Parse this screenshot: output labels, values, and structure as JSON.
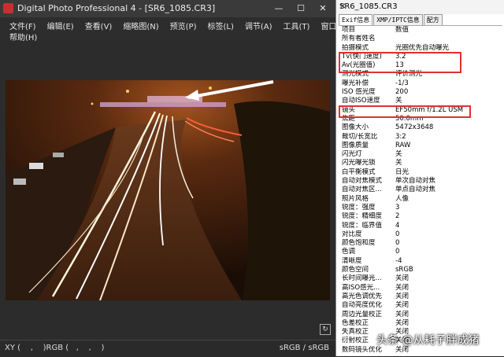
{
  "window": {
    "title": "Digital Photo Professional 4 - [SR6_1085.CR3]",
    "min_glyph": "—",
    "max_glyph": "☐",
    "close_glyph": "✕"
  },
  "menu": {
    "row1": [
      "文件(F)",
      "编辑(E)",
      "查看(V)",
      "缩略图(N)",
      "预览(P)",
      "标签(L)",
      "调节(A)",
      "工具(T)",
      "窗口(W)"
    ],
    "row2": [
      "帮助(H)"
    ]
  },
  "status": {
    "left": "XY (    ,    )RGB (   ,    ,    )",
    "right": "sRGB / sRGB"
  },
  "info_panel": {
    "title": "SR6_1085.CR3",
    "close_glyph": "✕",
    "tabs": [
      "Exif信息",
      "XMP/IPTC信息",
      "配方"
    ],
    "header": {
      "key": "项目",
      "value": "数值"
    },
    "rows": [
      {
        "k": "所有者姓名",
        "v": ""
      },
      {
        "k": "拍摄模式",
        "v": "光圈优先自动曝光"
      },
      {
        "k": "Tv(快门速度)",
        "v": "3.2"
      },
      {
        "k": "Av(光圈值)",
        "v": "13"
      },
      {
        "k": "测光模式",
        "v": "评价测光"
      },
      {
        "k": "曝光补偿",
        "v": "-1/3"
      },
      {
        "k": "ISO 感光度",
        "v": "200"
      },
      {
        "k": "自动ISO速度",
        "v": "关"
      },
      {
        "k": "镜头",
        "v": "EF50mm f/1.2L USM"
      },
      {
        "k": "焦距",
        "v": "50.0mm"
      },
      {
        "k": "图像大小",
        "v": "5472x3648"
      },
      {
        "k": "裁切/长宽比",
        "v": "3:2"
      },
      {
        "k": "图像质量",
        "v": "RAW"
      },
      {
        "k": "闪光灯",
        "v": "关"
      },
      {
        "k": "闪光曝光锁",
        "v": "关"
      },
      {
        "k": "白平衡模式",
        "v": "日光"
      },
      {
        "k": "自动对焦模式",
        "v": "单次自动对焦"
      },
      {
        "k": "自动对焦区...",
        "v": "单点自动对焦"
      },
      {
        "k": "照片风格",
        "v": "人像"
      },
      {
        "k": "锐度：强度",
        "v": "3"
      },
      {
        "k": "锐度：精细度",
        "v": "2"
      },
      {
        "k": "锐度：临界值",
        "v": "4"
      },
      {
        "k": "对比度",
        "v": "0"
      },
      {
        "k": "颜色饱和度",
        "v": "0"
      },
      {
        "k": "色调",
        "v": "0"
      },
      {
        "k": "清晰度",
        "v": "-4"
      },
      {
        "k": "颜色空间",
        "v": "sRGB"
      },
      {
        "k": "长时间曝光...",
        "v": "关闭"
      },
      {
        "k": "高ISO感光...",
        "v": "关闭"
      },
      {
        "k": "高光色调优先",
        "v": "关闭"
      },
      {
        "k": "自动亮度优化",
        "v": "关闭"
      },
      {
        "k": "周边光量校正",
        "v": "关闭"
      },
      {
        "k": "色差校正",
        "v": "关闭"
      },
      {
        "k": "失真校正",
        "v": "关闭"
      },
      {
        "k": "衍射校正",
        "v": "关闭"
      },
      {
        "k": "数码镜头优化",
        "v": "关闭"
      }
    ]
  },
  "watermark": "头条 @从耗子胖成猪",
  "colors": {
    "highlight": "#e03030",
    "window_bg": "#262626",
    "panel_bg": "#ffffff"
  }
}
